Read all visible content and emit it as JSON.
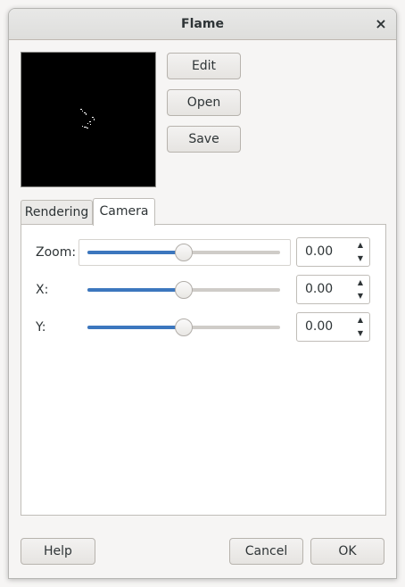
{
  "window": {
    "title": "Flame",
    "close_icon": "×"
  },
  "actions": {
    "edit": "Edit",
    "open": "Open",
    "save": "Save"
  },
  "tabs": [
    {
      "label": "Rendering",
      "active": false
    },
    {
      "label": "Camera",
      "active": true
    }
  ],
  "camera": {
    "zoom": {
      "label": "Zoom:",
      "value": "0.00",
      "slider_fraction": 0.5
    },
    "x": {
      "label": "X:",
      "value": "0.00",
      "slider_fraction": 0.5
    },
    "y": {
      "label": "Y:",
      "value": "0.00",
      "slider_fraction": 0.5
    }
  },
  "footer": {
    "help": "Help",
    "cancel": "Cancel",
    "ok": "OK"
  },
  "colors": {
    "accent": "#3c77be",
    "preview_bg": "#000000"
  }
}
